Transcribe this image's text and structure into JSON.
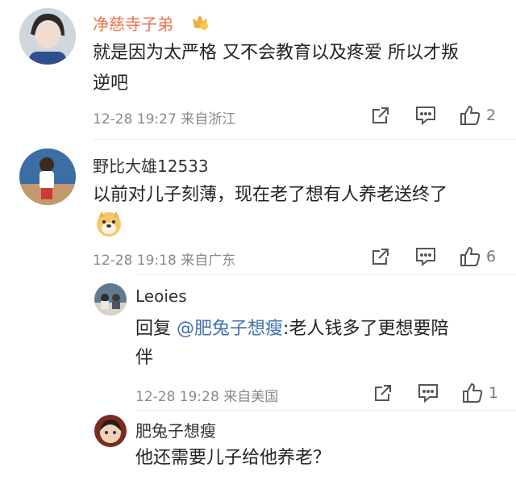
{
  "comments": [
    {
      "user": "净慈寺子弟",
      "badge_icon": "crown-badge-icon",
      "text_line1": "就是因为太严格 又不会教育以及疼爱 所以才叛",
      "text_line2": "逆吧",
      "time": "12-28 19:27",
      "location": "来自浙江",
      "likes": "2"
    },
    {
      "user": "野比大雄12533",
      "text": "以前对儿子刻薄，现在老了想有人养老送终了",
      "emoji": "doge-emoji",
      "time": "12-28 19:18",
      "location": "来自广东",
      "likes": "6"
    }
  ],
  "replies": [
    {
      "user": "Leoies",
      "reply_prefix": "回复",
      "mention": "@肥兔子想瘦",
      "text_line1": ":老人钱多了更想要陪",
      "text_line2": "伴",
      "time": "12-28 19:28",
      "location": "来自美国",
      "likes": "1"
    },
    {
      "user": "肥兔子想瘦",
      "text": "他还需要儿子给他养老？"
    }
  ],
  "colors": {
    "vip_name": "#eb7350",
    "mention": "#3f6fb0",
    "meta": "#8a8a8a"
  }
}
